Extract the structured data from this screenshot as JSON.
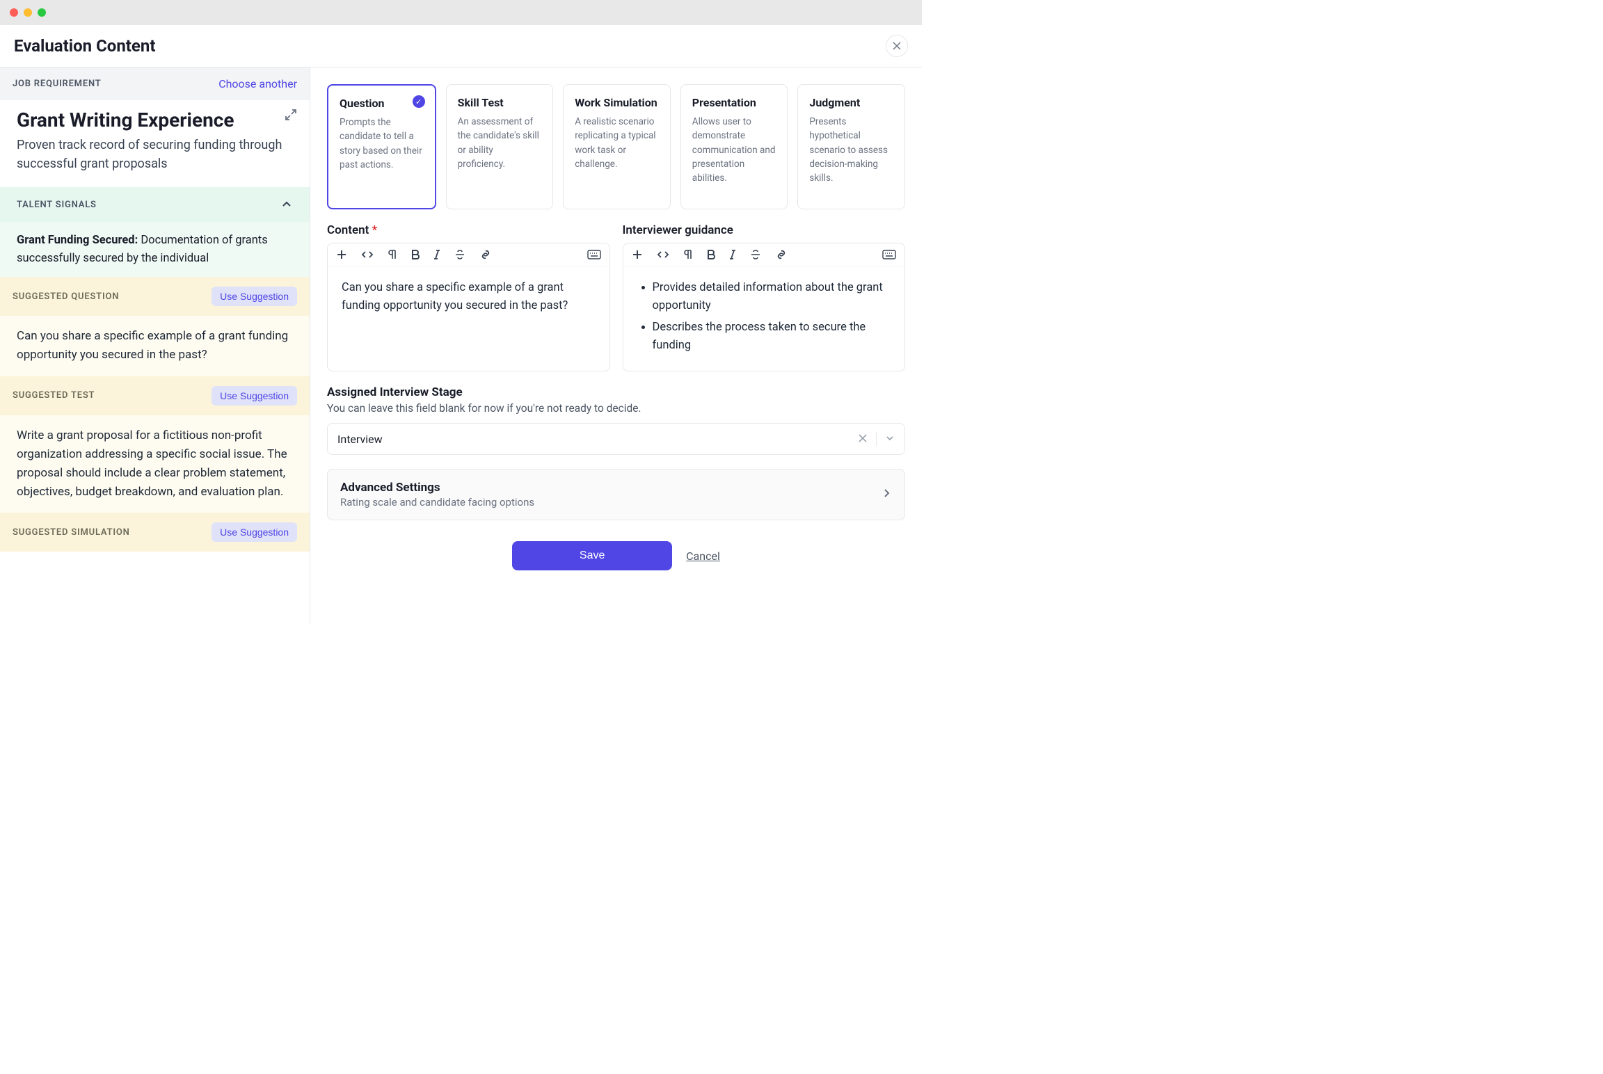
{
  "header": {
    "title": "Evaluation Content"
  },
  "sidebar": {
    "job_requirement_label": "JOB REQUIREMENT",
    "choose_another": "Choose another",
    "job_title": "Grant Writing Experience",
    "job_desc": "Proven track record of securing funding through successful grant proposals",
    "talent_signals_label": "TALENT SIGNALS",
    "talent_signal_title": "Grant Funding Secured:",
    "talent_signal_body": " Documentation of grants successfully secured by the individual",
    "suggested_question_label": "SUGGESTED QUESTION",
    "suggested_question_body": "Can you share a specific example of a grant funding opportunity you secured in the past?",
    "suggested_test_label": "SUGGESTED TEST",
    "suggested_test_body": "Write a grant proposal for a fictitious non-profit organization addressing a specific social issue. The proposal should include a clear problem statement, objectives, budget breakdown, and evaluation plan.",
    "suggested_simulation_label": "SUGGESTED SIMULATION",
    "use_suggestion_label": "Use Suggestion"
  },
  "main": {
    "types": [
      {
        "title": "Question",
        "desc": "Prompts the candidate to tell a story based on their past actions.",
        "selected": true
      },
      {
        "title": "Skill Test",
        "desc": "An assessment of the candidate's skill or ability proficiency.",
        "selected": false
      },
      {
        "title": "Work Simulation",
        "desc": "A realistic scenario replicating a typical work task or challenge.",
        "selected": false
      },
      {
        "title": "Presentation",
        "desc": "Allows user to demonstrate communication and presentation abilities.",
        "selected": false
      },
      {
        "title": "Judgment",
        "desc": "Presents hypothetical scenario to assess decision-making skills.",
        "selected": false
      }
    ],
    "content_label": "Content",
    "content_value": "Can you share a specific example of a grant funding opportunity you secured in the past?",
    "guidance_label": "Interviewer guidance",
    "guidance_items": [
      "Provides detailed information about the grant opportunity",
      "Describes the process taken to secure the funding"
    ],
    "stage": {
      "title": "Assigned Interview Stage",
      "hint": "You can leave this field blank for now if you're not ready to decide.",
      "value": "Interview"
    },
    "advanced": {
      "title": "Advanced Settings",
      "hint": "Rating scale and candidate facing options"
    },
    "save_label": "Save",
    "cancel_label": "Cancel"
  }
}
